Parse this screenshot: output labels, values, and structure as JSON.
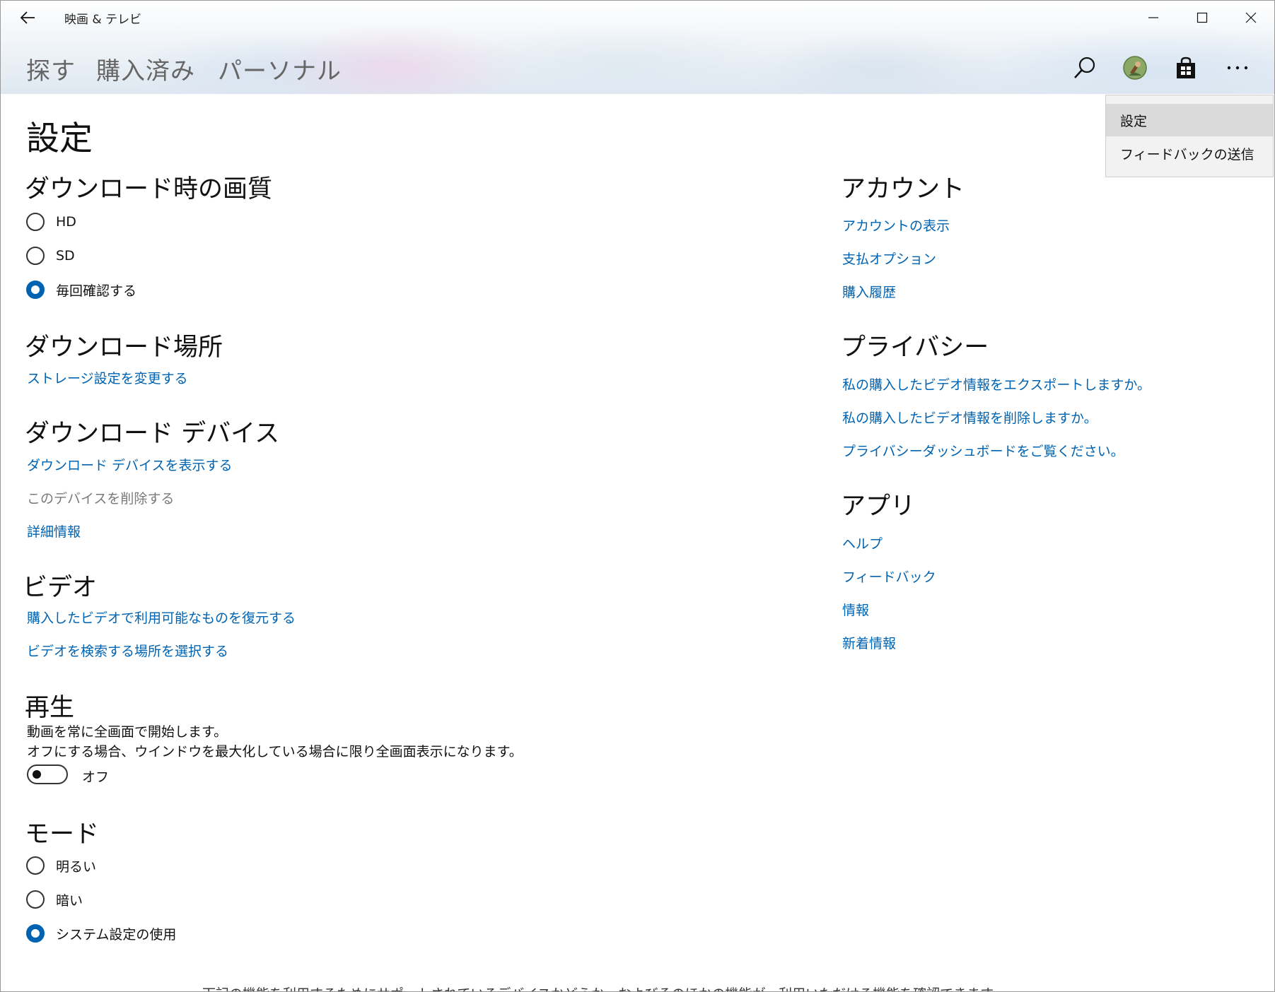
{
  "app": {
    "title": "映画 & テレビ"
  },
  "nav": {
    "tabs": [
      "探す",
      "購入済み",
      "パーソナル"
    ]
  },
  "page": {
    "title": "設定"
  },
  "quality": {
    "heading": "ダウンロード時の画質",
    "options": [
      "HD",
      "SD",
      "毎回確認する"
    ],
    "selected": "毎回確認する"
  },
  "location": {
    "heading": "ダウンロード場所",
    "link": "ストレージ設定を変更する"
  },
  "devices": {
    "heading": "ダウンロード デバイス",
    "show_link": "ダウンロード デバイスを表示する",
    "remove_text": "このデバイスを削除する",
    "details_link": "詳細情報"
  },
  "video": {
    "heading": "ビデオ",
    "restore_link": "購入したビデオで利用可能なものを復元する",
    "location_link": "ビデオを検索する場所を選択する"
  },
  "playback": {
    "heading": "再生",
    "desc1": "動画を常に全画面で開始します。",
    "desc2": "オフにする場合、ウインドウを最大化している場合に限り全画面表示になります。",
    "toggle_label": "オフ"
  },
  "mode": {
    "heading": "モード",
    "options": [
      "明るい",
      "暗い",
      "システム設定の使用"
    ],
    "selected": "システム設定の使用"
  },
  "account": {
    "heading": "アカウント",
    "links": [
      "アカウントの表示",
      "支払オプション",
      "購入履歴"
    ]
  },
  "privacy": {
    "heading": "プライバシー",
    "links": [
      "私の購入したビデオ情報をエクスポートしますか。",
      "私の購入したビデオ情報を削除しますか。",
      "プライバシーダッシュボードをご覧ください。"
    ]
  },
  "apps": {
    "heading": "アプリ",
    "links": [
      "ヘルプ",
      "フィードバック",
      "情報",
      "新着情報"
    ]
  },
  "menu": {
    "items": [
      "設定",
      "フィードバックの送信"
    ]
  },
  "background_text": "下記の機能を利用するためにサポートされているデバイスかどうか、およびそのほかの機能が、利用いただける機能を確認できます。",
  "colors": {
    "accent": "#0063b1",
    "link": "#0063b1",
    "disabled": "#7a7a7a"
  },
  "icons": {
    "back": "back-arrow-icon",
    "minimize": "minimize-icon",
    "maximize": "maximize-icon",
    "close": "close-icon",
    "search": "search-icon",
    "avatar": "avatar",
    "store": "store-bag-icon",
    "more": "more-ellipsis-icon"
  }
}
